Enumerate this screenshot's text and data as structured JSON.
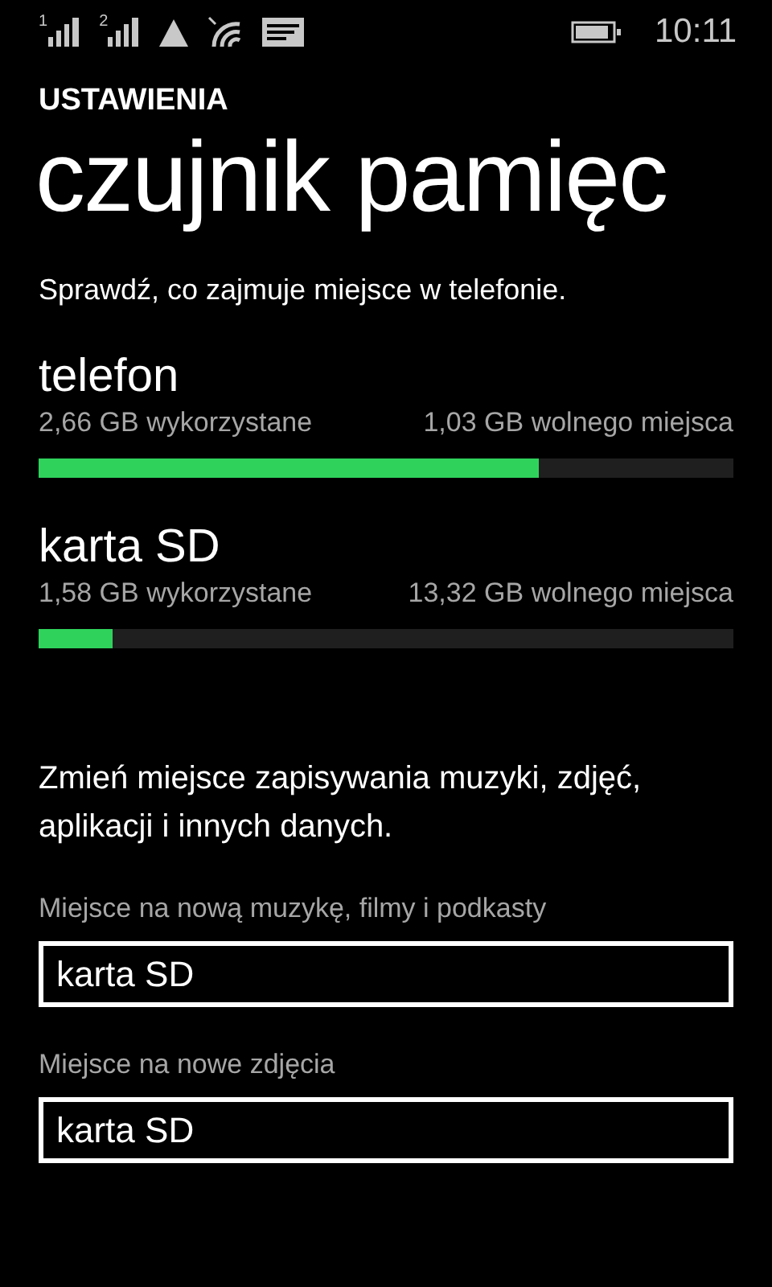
{
  "status_bar": {
    "sims": [
      {
        "label": "1"
      },
      {
        "label": "2"
      }
    ],
    "time": "10:11"
  },
  "header": {
    "app_title": "USTAWIENIA",
    "page_title": "czujnik pamięc"
  },
  "intro": "Sprawdź, co zajmuje miejsce w telefonie.",
  "storage": [
    {
      "name": "telefon",
      "used": "2,66 GB wykorzystane",
      "free": "1,03 GB wolnego miejsca",
      "level": 0.72
    },
    {
      "name": "karta SD",
      "used": "1,58 GB wykorzystane",
      "free": "13,32 GB wolnego miejsca",
      "level": 0.106
    }
  ],
  "change_text": "Zmień miejsce zapisywania muzyki, zdjęć, aplikacji i innych danych.",
  "locations": [
    {
      "label": "Miejsce na nową muzykę, filmy i podkasty",
      "value": "karta SD"
    },
    {
      "label": "Miejsce na nowe zdjęcia",
      "value": "karta SD"
    }
  ]
}
